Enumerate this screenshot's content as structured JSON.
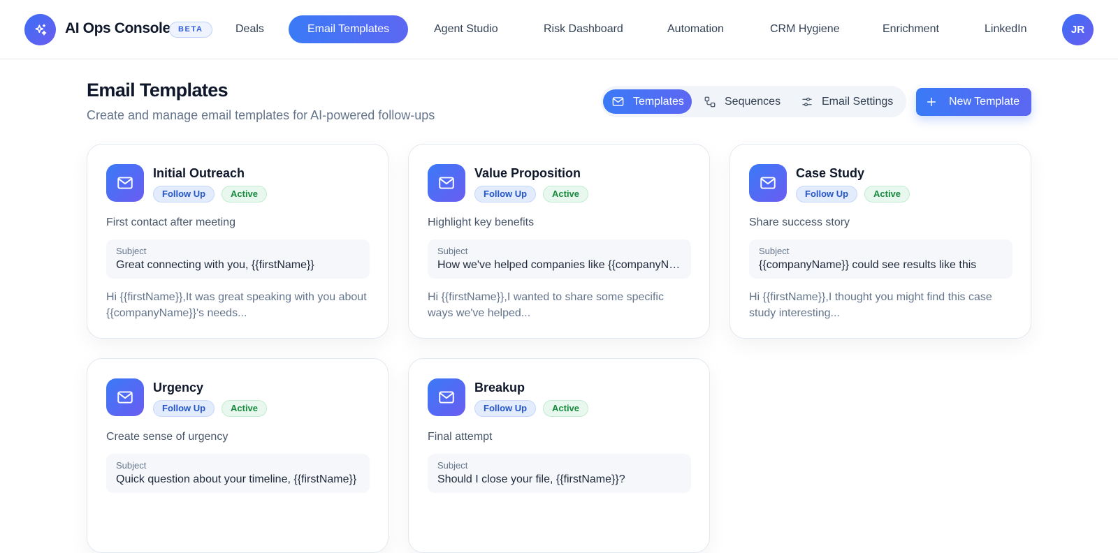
{
  "app": {
    "title": "AI Ops Console",
    "badge": "BETA",
    "avatar_initials": "JR"
  },
  "nav": {
    "items": [
      {
        "label": "Deals",
        "active": false
      },
      {
        "label": "Email Templates",
        "active": true
      },
      {
        "label": "Agent Studio",
        "active": false
      },
      {
        "label": "Risk Dashboard",
        "active": false
      },
      {
        "label": "Automation",
        "active": false
      },
      {
        "label": "CRM Hygiene",
        "active": false
      },
      {
        "label": "Enrichment",
        "active": false
      },
      {
        "label": "LinkedIn",
        "active": false
      }
    ]
  },
  "header": {
    "title": "Email Templates",
    "subtitle": "Create and manage email templates for AI-powered follow-ups"
  },
  "tabs": {
    "items": [
      {
        "label": "Templates",
        "icon": "mail-icon",
        "active": true
      },
      {
        "label": "Sequences",
        "icon": "sequence-icon",
        "active": false
      },
      {
        "label": "Email Settings",
        "icon": "settings-sliders-icon",
        "active": false
      }
    ]
  },
  "actions": {
    "new_template_label": "New Template"
  },
  "templates": [
    {
      "name": "Initial Outreach",
      "type": "Follow Up",
      "status": "Active",
      "description": "First contact after meeting",
      "subject_label": "Subject",
      "subject": "Great connecting with you, {{firstName}}",
      "preview": "Hi {{firstName}},It was great speaking with you about {{companyName}}'s needs..."
    },
    {
      "name": "Value Proposition",
      "type": "Follow Up",
      "status": "Active",
      "description": "Highlight key benefits",
      "subject_label": "Subject",
      "subject": "How we've helped companies like {{companyName}}",
      "preview": "Hi {{firstName}},I wanted to share some specific ways we've helped..."
    },
    {
      "name": "Case Study",
      "type": "Follow Up",
      "status": "Active",
      "description": "Share success story",
      "subject_label": "Subject",
      "subject": "{{companyName}} could see results like this",
      "preview": "Hi {{firstName}},I thought you might find this case study interesting..."
    },
    {
      "name": "Urgency",
      "type": "Follow Up",
      "status": "Active",
      "description": "Create sense of urgency",
      "subject_label": "Subject",
      "subject": "Quick question about your timeline, {{firstName}}",
      "preview": ""
    },
    {
      "name": "Breakup",
      "type": "Follow Up",
      "status": "Active",
      "description": "Final attempt",
      "subject_label": "Subject",
      "subject": "Should I close your file, {{firstName}}?",
      "preview": ""
    }
  ],
  "colors": {
    "accent_start": "#3a7af7",
    "accent_end": "#5c67f2",
    "type_pill_bg": "#e3ecfd",
    "status_pill_bg": "#e8f8ee",
    "status_pill_text": "#188a3e"
  }
}
